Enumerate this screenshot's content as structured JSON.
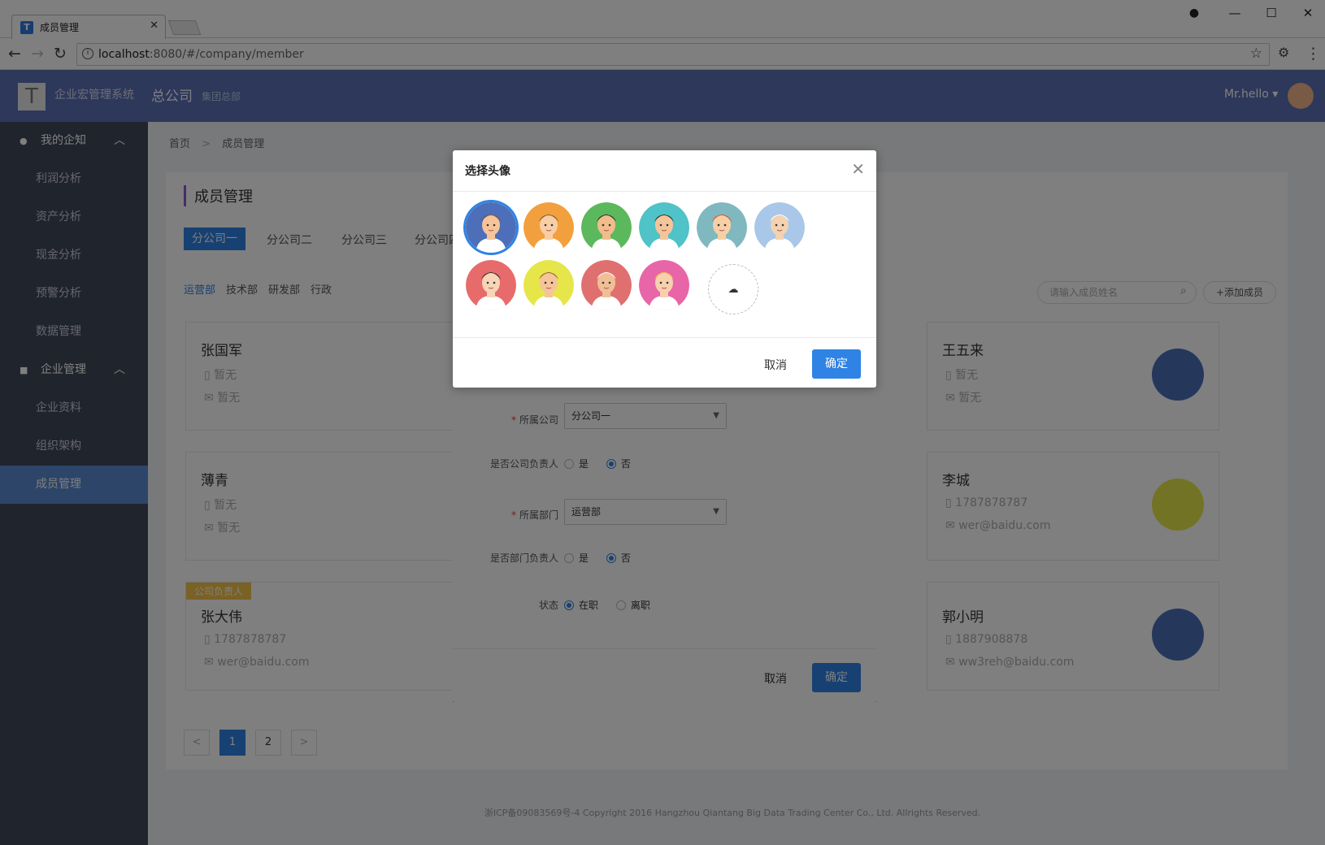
{
  "browser": {
    "tab_title": "成员管理",
    "tab_favicon": "T",
    "url_host": "localhost",
    "url_rest": ":8080/#/company/member"
  },
  "app": {
    "logo_letter": "T",
    "system_name": "企业宏管理系统",
    "company_title": "总公司",
    "company_sub": "集团总部",
    "user_name": "Mr.hello ▾"
  },
  "sidebar": {
    "groups": [
      {
        "label": "我的企知",
        "items": [
          "利润分析",
          "资产分析",
          "现金分析",
          "预警分析",
          "数据管理"
        ]
      },
      {
        "label": "企业管理",
        "items": [
          "企业资料",
          "组织架构",
          "成员管理"
        ]
      }
    ]
  },
  "breadcrumb": {
    "home": "首页",
    "sep": ">",
    "current": "成员管理"
  },
  "page": {
    "title": "成员管理",
    "company_tabs": [
      "分公司一",
      "分公司二",
      "分公司三",
      "分公司四"
    ],
    "dept_tabs": [
      "运营部",
      "技术部",
      "研发部",
      "行政"
    ],
    "search_placeholder": "请输入成员姓名",
    "add_button": "+添加成员"
  },
  "members": [
    {
      "name": "张国军",
      "phone": "暂无",
      "email": "暂无",
      "badge": ""
    },
    {
      "name": "薄青",
      "phone": "暂无",
      "email": "暂无",
      "badge": ""
    },
    {
      "name": "张大伟",
      "phone": "1787878787",
      "email": "wer@baidu.com",
      "badge": "公司负责人"
    },
    {
      "name": "王五来",
      "phone": "暂无",
      "email": "暂无",
      "badge": ""
    },
    {
      "name": "李城",
      "phone": "1787878787",
      "email": "wer@baidu.com",
      "badge": ""
    },
    {
      "name": "郭小明",
      "phone": "1887908878",
      "email": "ww3reh@baidu.com",
      "badge": ""
    }
  ],
  "pagination": {
    "prev": "<",
    "pages": [
      "1",
      "2"
    ],
    "next": ">"
  },
  "footer": "浙ICP备09083569号-4 Copyright 2016 Hangzhou Qiantang Big Data Trading Center Co., Ltd. Allrights Reserved.",
  "member_form": {
    "company_label": "所属公司",
    "company_value": "分公司一",
    "company_head_label": "是否公司负责人",
    "dept_label": "所属部门",
    "dept_value": "运营部",
    "dept_head_label": "是否部门负责人",
    "status_label": "状态",
    "yes": "是",
    "no": "否",
    "active": "在职",
    "left": "离职",
    "cancel": "取消",
    "ok": "确定"
  },
  "avatar_dialog": {
    "title": "选择头像",
    "upload_icon": "upload-cloud-icon",
    "cancel": "取消",
    "ok": "确定",
    "avatar_colors": [
      "#4d6eb8",
      "#f2a03d",
      "#5cb85c",
      "#4fc3c7",
      "#7fb9bf",
      "#a9c7e8",
      "#e86b6b",
      "#e6e64a",
      "#e07070",
      "#e865a8"
    ]
  },
  "colors": {
    "primary": "#2e83e4",
    "topbar": "#5a71b7",
    "sidebar": "#41495a",
    "badge": "#f5c248"
  }
}
